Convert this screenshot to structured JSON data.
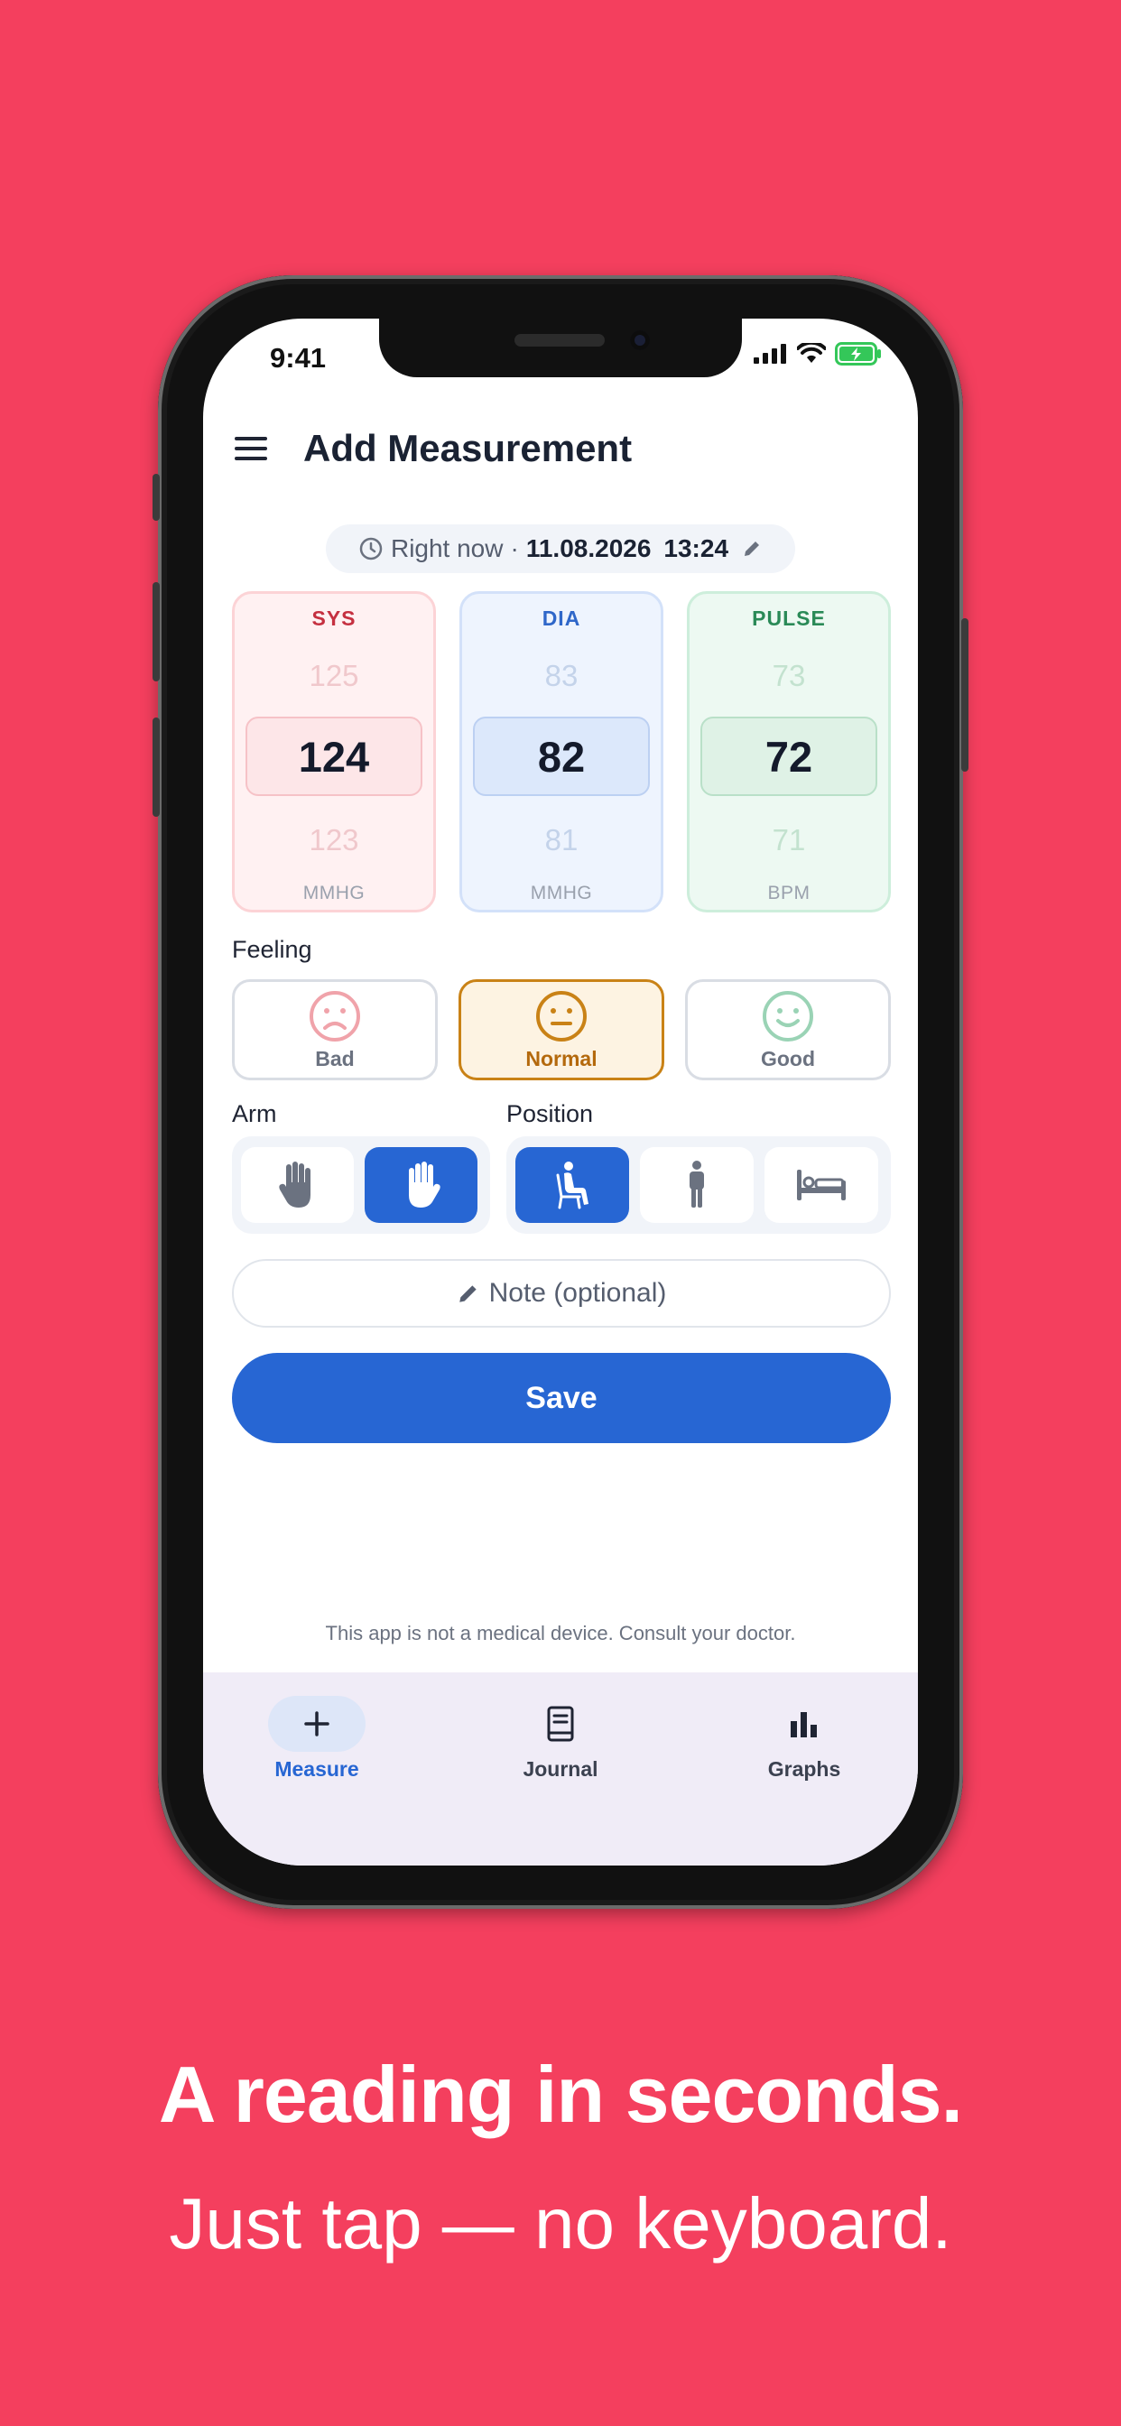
{
  "status_bar": {
    "time": "9:41"
  },
  "header": {
    "title": "Add Measurement"
  },
  "datetime": {
    "label": "Right now",
    "separator": "·",
    "date": "11.08.2026",
    "time": "13:24"
  },
  "pickers": [
    {
      "label": "SYS",
      "above": "125",
      "value": "124",
      "below": "123",
      "unit": "MMHG"
    },
    {
      "label": "DIA",
      "above": "83",
      "value": "82",
      "below": "81",
      "unit": "MMHG"
    },
    {
      "label": "PULSE",
      "above": "73",
      "value": "72",
      "below": "71",
      "unit": "BPM"
    }
  ],
  "feeling": {
    "label": "Feeling",
    "options": [
      {
        "label": "Bad",
        "icon": "sad-face-icon",
        "color": "#f0a3aa"
      },
      {
        "label": "Normal",
        "icon": "neutral-face-icon",
        "color": "#c98216",
        "selected": true
      },
      {
        "label": "Good",
        "icon": "happy-face-icon",
        "color": "#9ad3b5"
      }
    ]
  },
  "arm": {
    "label": "Arm",
    "options": [
      "left-hand-icon",
      "right-hand-icon"
    ],
    "selected": "right"
  },
  "position": {
    "label": "Position",
    "options": [
      "sitting-icon",
      "standing-icon",
      "lying-icon"
    ],
    "selected": "sitting"
  },
  "note": {
    "placeholder": "Note (optional)"
  },
  "save": {
    "label": "Save"
  },
  "disclaimer": "This app is not a medical device. Consult your doctor.",
  "nav": [
    {
      "label": "Measure",
      "icon": "plus-icon",
      "active": true
    },
    {
      "label": "Journal",
      "icon": "journal-icon"
    },
    {
      "label": "Graphs",
      "icon": "bar-chart-icon"
    }
  ],
  "marketing": {
    "headline": "A reading in seconds.",
    "subline": "Just tap — no keyboard."
  },
  "colors": {
    "background": "#f43f5e",
    "accent": "#2766d3"
  }
}
